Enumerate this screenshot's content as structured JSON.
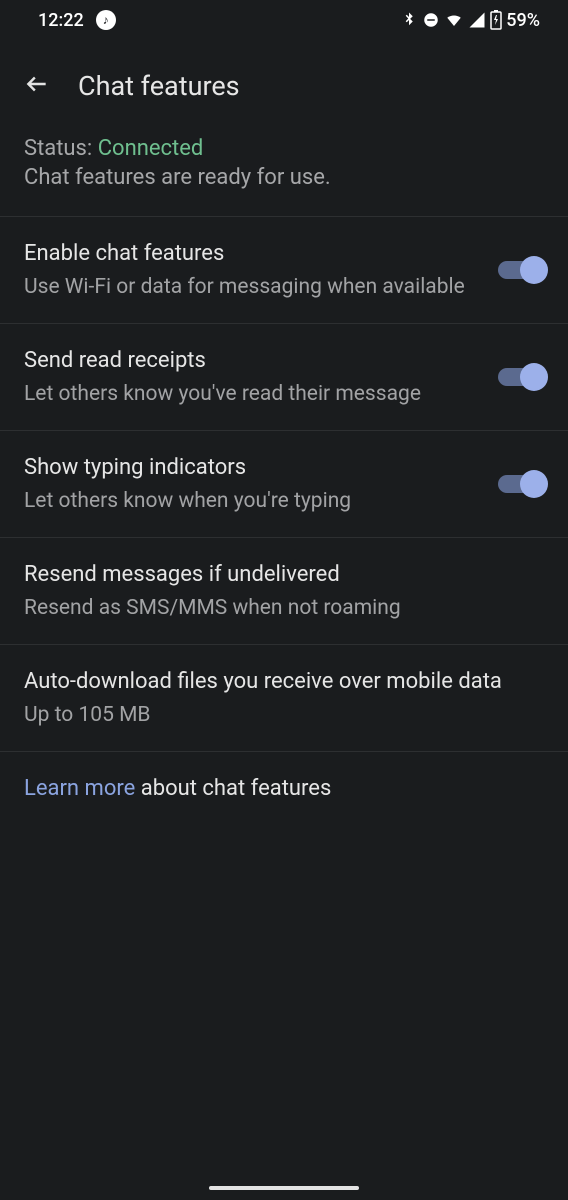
{
  "statusBar": {
    "time": "12:22",
    "battery": "59%"
  },
  "header": {
    "title": "Chat features"
  },
  "status": {
    "label": "Status: ",
    "value": "Connected",
    "desc": "Chat features are ready for use."
  },
  "settings": {
    "enable": {
      "title": "Enable chat features",
      "desc": "Use Wi-Fi or data for messaging when available"
    },
    "readReceipts": {
      "title": "Send read receipts",
      "desc": "Let others know you've read their message"
    },
    "typing": {
      "title": "Show typing indicators",
      "desc": "Let others know when you're typing"
    },
    "resend": {
      "title": "Resend messages if undelivered",
      "desc": "Resend as SMS/MMS when not roaming"
    },
    "autodownload": {
      "title": "Auto-download files you receive over mobile data",
      "desc": "Up to 105 MB"
    }
  },
  "learn": {
    "link": "Learn more",
    "rest": " about chat features"
  }
}
